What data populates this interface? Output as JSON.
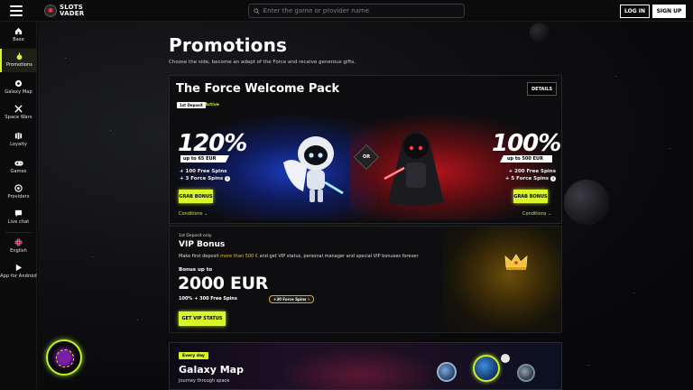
{
  "header": {
    "logo_text_line1": "SLOTS",
    "logo_text_line2": "VADER",
    "search_placeholder": "Enter the game or provider name",
    "login_label": "LOG IN",
    "signup_label": "SIGN UP"
  },
  "sidebar": {
    "items": [
      {
        "label": "Base",
        "icon": "home-icon"
      },
      {
        "label": "Promotions",
        "icon": "promotions-icon",
        "active": true
      },
      {
        "label": "Galaxy Map",
        "icon": "galaxy-map-icon"
      },
      {
        "label": "Space Wars",
        "icon": "space-wars-icon"
      },
      {
        "label": "Loyalty",
        "icon": "loyalty-icon"
      },
      {
        "label": "Games",
        "icon": "gamepad-icon"
      },
      {
        "label": "Providers",
        "icon": "providers-icon"
      },
      {
        "label": "Live chat",
        "icon": "chat-icon"
      },
      {
        "label": "English",
        "icon": "uk-flag-icon"
      },
      {
        "label": "App for Android",
        "icon": "play-icon"
      }
    ]
  },
  "page": {
    "title": "Promotions",
    "subtitle": "Choose the side, become an adept of the Force and receive generous gifts."
  },
  "welcome_pack": {
    "title": "The Force Welcome Pack",
    "details_label": "DETAILS",
    "deposit_badge": "1st Deposit",
    "status": "Active",
    "or_label": "OR",
    "left": {
      "percent": "120%",
      "upto": "up to 65 EUR",
      "spins_line1": "+ 100 Free Spins",
      "spins_line2": "+ 3 Force Spins",
      "button": "GRAB BONUS",
      "conditions": "Conditions"
    },
    "right": {
      "percent": "100%",
      "upto": "up to 500 EUR",
      "spins_line1": "+ 200 Free Spins",
      "spins_line2": "+ 5 Force Spins",
      "button": "GRAB BONUS",
      "conditions": "Conditions"
    },
    "colors": {
      "light_side": "#1a3cbd",
      "dark_side": "#b0141c",
      "accent": "#d9f72a"
    }
  },
  "vip": {
    "small_label": "1st Deposit only",
    "title": "VIP Bonus",
    "desc_prefix": "Make first deposit ",
    "desc_highlight": "more than 500 €",
    "desc_suffix": " and get VIP status, personal manager and special VIP bonuses forever",
    "bonus_label": "Bonus up to",
    "amount": "2000 EUR",
    "spins": "100% + 300 Free Spins",
    "force_badge": "+30 Force Spins",
    "button": "GET VIP STATUS"
  },
  "galaxy": {
    "badge": "Every day",
    "title": "Galaxy Map",
    "subtitle": "Journey through space"
  }
}
